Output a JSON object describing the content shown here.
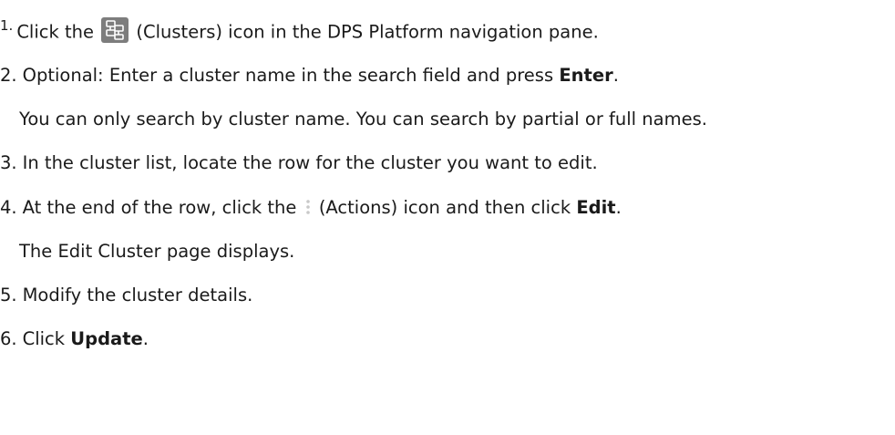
{
  "steps": [
    {
      "number": "1.",
      "pre": "Click the",
      "icon": "clusters-icon",
      "post": "(Clusters) icon in the DPS Platform navigation pane."
    },
    {
      "number": "2.",
      "pre": "Optional: Enter a cluster name in the search field and press",
      "bold": "Enter",
      "post": ".",
      "note": "You can only search by cluster name. You can search by partial or full names."
    },
    {
      "number": "3.",
      "text": "In the cluster list, locate the row for the cluster you want to edit."
    },
    {
      "number": "4.",
      "pre": "At the end of the row, click the",
      "icon": "actions-icon",
      "mid": "(Actions) icon and then click",
      "bold": "Edit",
      "post": ".",
      "note": "The Edit Cluster page displays."
    },
    {
      "number": "5.",
      "text": "Modify the cluster details."
    },
    {
      "number": "6.",
      "pre": "Click",
      "bold": "Update",
      "post": "."
    }
  ]
}
